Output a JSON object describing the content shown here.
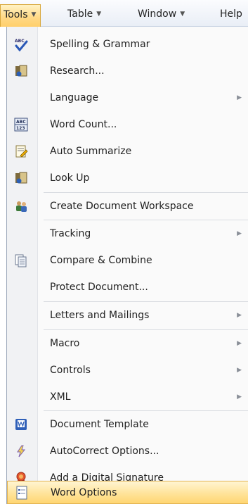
{
  "menubar": {
    "items": [
      {
        "label": "Tools",
        "active": true
      },
      {
        "label": "Table",
        "active": false
      },
      {
        "label": "Window",
        "active": false
      },
      {
        "label": "Help",
        "active": false
      }
    ],
    "dropdown_arrow": "▼"
  },
  "menu": {
    "items": [
      {
        "label": "Spelling & Grammar",
        "icon": "spelling-grammar-icon"
      },
      {
        "label": "Research...",
        "icon": "research-icon"
      },
      {
        "label": "Language",
        "icon": null,
        "submenu_arrow": "▶"
      },
      {
        "label": "Word Count...",
        "icon": "word-count-icon"
      },
      {
        "label": "Auto Summarize",
        "icon": "auto-summarize-icon"
      },
      {
        "label": "Look Up",
        "icon": "look-up-icon"
      },
      {
        "label": "Create Document Workspace",
        "icon": "document-workspace-icon"
      },
      {
        "label": "Tracking",
        "icon": null,
        "submenu_arrow": "▶"
      },
      {
        "label": "Compare & Combine",
        "icon": "compare-combine-icon"
      },
      {
        "label": "Protect Document...",
        "icon": null
      },
      {
        "label": "Letters and Mailings",
        "icon": null,
        "submenu_arrow": "▶"
      },
      {
        "label": "Macro",
        "icon": null,
        "submenu_arrow": "▶"
      },
      {
        "label": "Controls",
        "icon": null,
        "submenu_arrow": "▶"
      },
      {
        "label": "XML",
        "icon": null,
        "submenu_arrow": "▶"
      },
      {
        "label": "Document Template",
        "icon": "document-template-icon"
      },
      {
        "label": "AutoCorrect Options...",
        "icon": "autocorrect-icon"
      },
      {
        "label": "Add a Digital Signature",
        "icon": "digital-signature-icon"
      },
      {
        "label": "Word Options",
        "icon": "word-options-icon",
        "highlighted": true
      }
    ],
    "word_count_icon_text": {
      "top": "ABC",
      "bottom": "123"
    },
    "spelling_icon_text": "ABC"
  },
  "colors": {
    "active_menu_fill": "#ffd884",
    "active_menu_border": "#d9a83c",
    "highlight_fill": "#ffe39a",
    "highlight_border": "#e3b452",
    "gutter": "#f1f2f4",
    "separator": "#d9dce1"
  }
}
